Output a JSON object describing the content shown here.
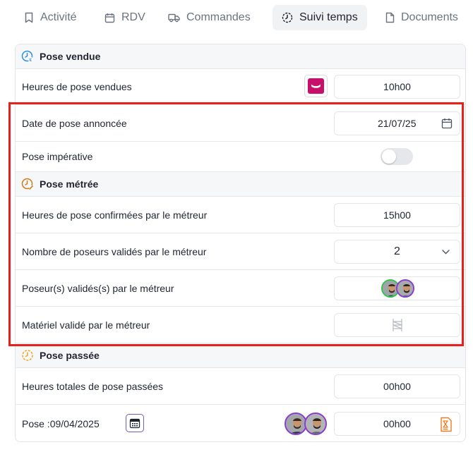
{
  "tabs": [
    {
      "label": "Activité",
      "icon": "bookmark-icon"
    },
    {
      "label": "RDV",
      "icon": "calendar-icon"
    },
    {
      "label": "Commandes",
      "icon": "truck-icon"
    },
    {
      "label": "Suivi temps",
      "icon": "clock-icon",
      "active": true
    },
    {
      "label": "Documents",
      "icon": "document-icon"
    }
  ],
  "sections": {
    "pose_vendue": "Pose vendue",
    "pose_metree": "Pose métrée",
    "pose_passee": "Pose passée"
  },
  "rows": {
    "heures_vendues": {
      "label": "Heures de pose vendues",
      "value": "10h00"
    },
    "date_annoncee": {
      "label": "Date de pose annoncée",
      "value": "21/07/25"
    },
    "pose_imperative": {
      "label": "Pose impérative",
      "checked": false
    },
    "heures_confirmees": {
      "label": "Heures de pose confirmées par le métreur",
      "value": "15h00"
    },
    "nombre_poseurs": {
      "label": "Nombre de poseurs validés par le métreur",
      "value": "2"
    },
    "poseurs_valides": {
      "label": "Poseur(s) validés(s) par le métreur"
    },
    "materiel_valide": {
      "label": "Matériel validé par le métreur"
    },
    "heures_passees": {
      "label": "Heures totales de pose passées",
      "value": "00h00"
    },
    "pose_date": {
      "label": "Pose :09/04/2025",
      "value": "00h00"
    }
  },
  "colors": {
    "highlight": "#e8201a",
    "brand_badge": "#c8106a",
    "calendar_button": "#6d5bd0",
    "hourglass": "#f07a1e",
    "avatar_ring_green": "#33c24d",
    "avatar_ring_purple": "#8a3bd1"
  }
}
